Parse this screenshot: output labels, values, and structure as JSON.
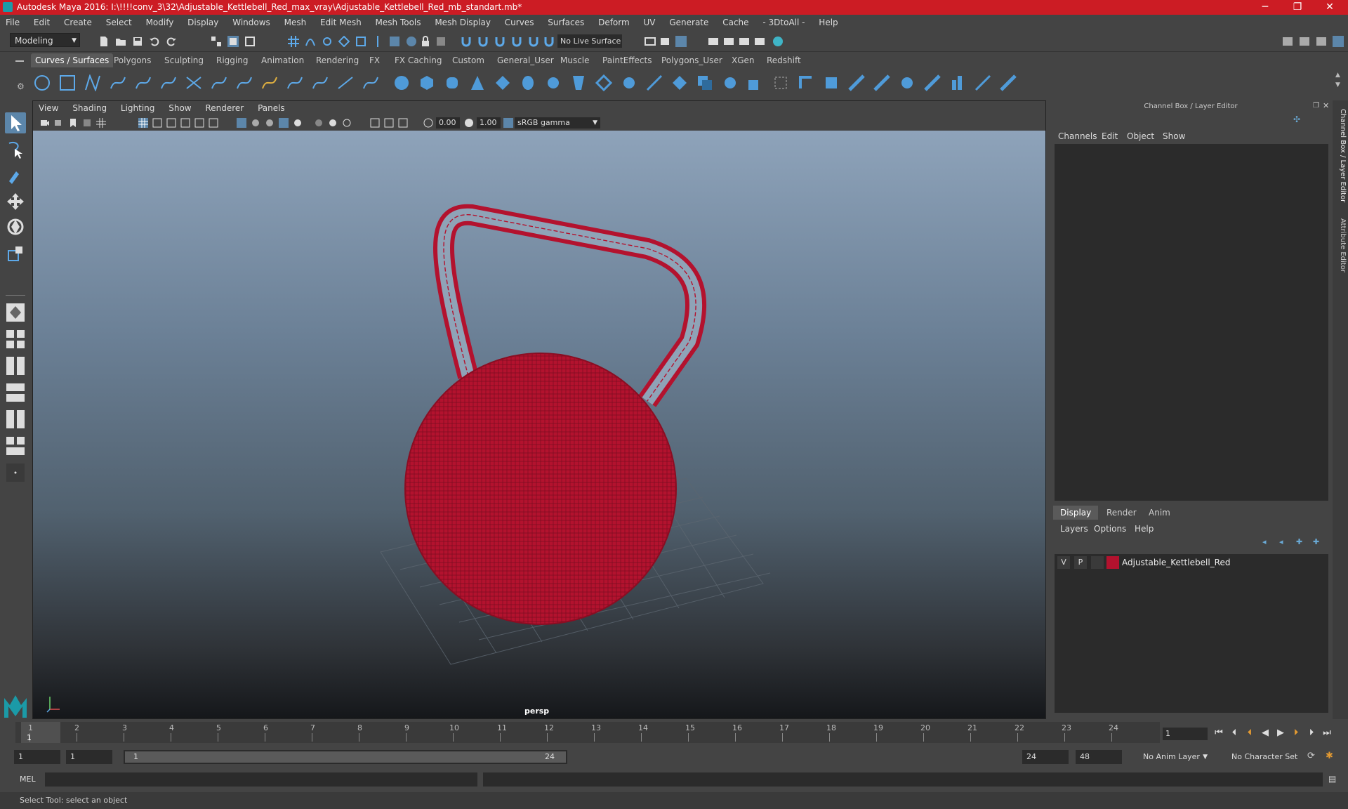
{
  "window": {
    "title": "Autodesk Maya 2016: I:\\!!!!conv_3\\32\\Adjustable_Kettlebell_Red_max_vray\\Adjustable_Kettlebell_Red_mb_standart.mb*",
    "minimize": "─",
    "maximize": "❐",
    "close": "✕"
  },
  "menubar": [
    "File",
    "Edit",
    "Create",
    "Select",
    "Modify",
    "Display",
    "Windows",
    "Mesh",
    "Edit Mesh",
    "Mesh Tools",
    "Mesh Display",
    "Curves",
    "Surfaces",
    "Deform",
    "UV",
    "Generate",
    "Cache",
    "- 3DtoAll -",
    "Help"
  ],
  "statusline": {
    "mode": "Modeling",
    "live_surface": "No Live Surface"
  },
  "shelf": {
    "tabs": [
      "Curves / Surfaces",
      "Polygons",
      "Sculpting",
      "Rigging",
      "Animation",
      "Rendering",
      "FX",
      "FX Caching",
      "Custom",
      "General_User",
      "Muscle",
      "PaintEffects",
      "Polygons_User",
      "XGen",
      "Redshift"
    ],
    "active_tab": "Curves / Surfaces"
  },
  "viewport": {
    "menu": [
      "View",
      "Shading",
      "Lighting",
      "Show",
      "Renderer",
      "Panels"
    ],
    "exposure": "0.00",
    "gamma": "1.00",
    "color_space": "sRGB gamma",
    "camera": "persp"
  },
  "channel_box": {
    "title": "Channel Box / Layer Editor",
    "menu": [
      "Channels",
      "Edit",
      "Object",
      "Show"
    ]
  },
  "layer_editor": {
    "tabs": [
      "Display",
      "Render",
      "Anim"
    ],
    "active_tab": "Display",
    "menu": [
      "Layers",
      "Options",
      "Help"
    ],
    "layers": [
      {
        "visible": "V",
        "playback": "P",
        "color": "#b3122e",
        "name": "Adjustable_Kettlebell_Red"
      }
    ]
  },
  "side_tabs": [
    "Channel Box / Layer Editor",
    "Attribute Editor"
  ],
  "timeline": {
    "ticks": [
      "1",
      "2",
      "3",
      "4",
      "5",
      "6",
      "7",
      "8",
      "9",
      "10",
      "11",
      "12",
      "13",
      "14",
      "15",
      "16",
      "17",
      "18",
      "19",
      "20",
      "21",
      "22",
      "23",
      "24"
    ],
    "current_marker": "1",
    "current_frame": "1"
  },
  "range": {
    "start": "1",
    "playback_start": "1",
    "handle_start": "1",
    "handle_end": "24",
    "playback_end": "24",
    "end": "48",
    "anim_layer": "No Anim Layer",
    "character_set": "No Character Set"
  },
  "command": {
    "language": "MEL"
  },
  "help_line": "Select Tool: select an object",
  "colors": {
    "title_bar": "#cc1c24",
    "wireframe": "#b3122e",
    "accent": "#5c86aa"
  }
}
